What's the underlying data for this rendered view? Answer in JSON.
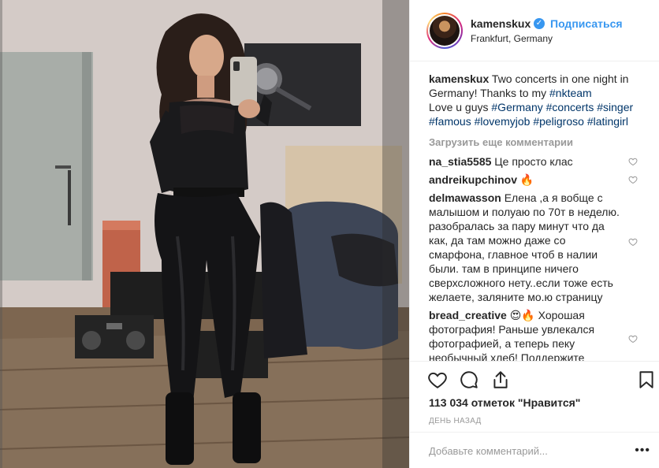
{
  "post": {
    "username": "kamenskux",
    "follow_label": "Подписаться",
    "separator": "•",
    "location": "Frankfurt, Germany",
    "verified_mark": "✓"
  },
  "caption": {
    "username": "kamenskux",
    "text1": " Two concerts in one night in Germany! Thanks to my ",
    "tag_team": "#nkteam",
    "text2": "Love u guys ",
    "tags": [
      "#Germany",
      "#concerts",
      "#singer",
      "#famous",
      "#lovemyjob",
      "#peligroso",
      "#latingirl"
    ]
  },
  "load_more_label": "Загрузить еще комментарии",
  "comments": [
    {
      "user": "na_stia5585",
      "text": " Це просто клас"
    },
    {
      "user": "andreikupchinov",
      "text": " 🔥"
    },
    {
      "user": "delmawasson",
      "text": " Елена ,а я вобще с малышом и полуаю по 70т в неделю. разобралась за пару минут что да как, да там можно даже со смарфона, главное чтоб в налии были. там в принципе ничего сверхсложного нету..если тоже есть желаете, заляните мо.ю страницу"
    },
    {
      "user": "bread_creative",
      "text": " 😍🔥 Хорошая фотография! Раньше увлекался фотографией, а теперь пеку необычный хлеб! Поддержите"
    }
  ],
  "actions": {
    "likes": "113 034 отметок \"Нравится\"",
    "time": "ДЕНЬ НАЗАД"
  },
  "add_comment": {
    "placeholder": "Добавьте комментарий...",
    "more": "•••"
  },
  "colors": {
    "link": "#3897f0",
    "hashtag": "#003569",
    "muted": "#999999"
  },
  "icons": [
    "heart-icon",
    "comment-icon",
    "share-icon",
    "bookmark-icon",
    "verified-icon",
    "comment-heart-icon"
  ]
}
